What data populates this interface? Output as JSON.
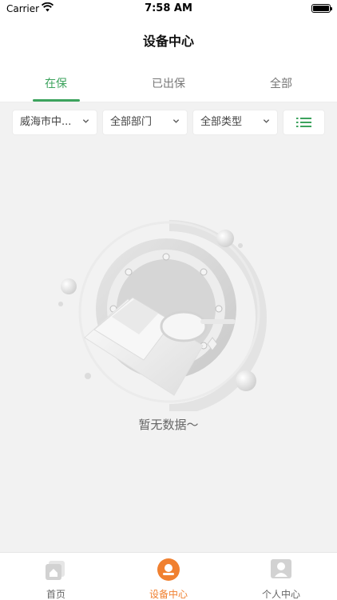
{
  "status_bar": {
    "carrier": "Carrier",
    "time": "7:58 AM"
  },
  "header": {
    "title": "设备中心"
  },
  "tabs": [
    {
      "label": "在保",
      "active": true
    },
    {
      "label": "已出保",
      "active": false
    },
    {
      "label": "全部",
      "active": false
    }
  ],
  "filters": {
    "region": "威海市中...",
    "department": "全部部门",
    "type": "全部类型"
  },
  "empty_state": {
    "message": "暂无数据～"
  },
  "tabbar": [
    {
      "label": "首页",
      "active": false
    },
    {
      "label": "设备中心",
      "active": true
    },
    {
      "label": "个人中心",
      "active": false
    }
  ],
  "colors": {
    "accent": "#3ca35d",
    "tabbar_active": "#f08030"
  }
}
